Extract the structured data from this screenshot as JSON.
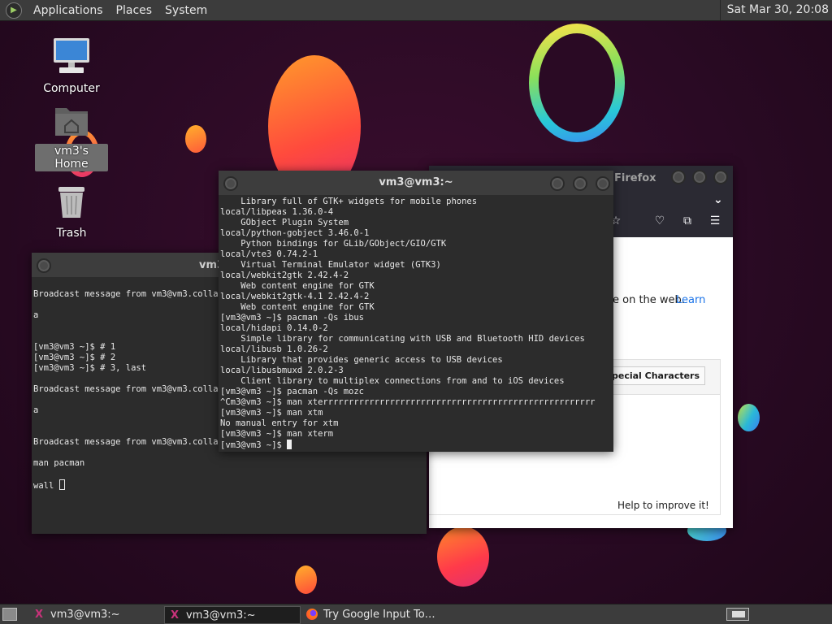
{
  "top_panel": {
    "menus": [
      "Applications",
      "Places",
      "System"
    ],
    "clock": "Sat Mar 30, 20:08"
  },
  "desktop": {
    "icons": [
      {
        "label": "Computer",
        "icon": "computer-icon"
      },
      {
        "label": "vm3's Home",
        "icon": "home-folder-icon"
      },
      {
        "label": "Trash",
        "icon": "trash-icon"
      }
    ]
  },
  "terminal_back": {
    "title": "vm3",
    "lines": [
      "",
      "Broadcast message from vm3@vm3.collabn",
      "",
      "a",
      "",
      "",
      "[vm3@vm3 ~]$ # 1",
      "[vm3@vm3 ~]$ # 2",
      "[vm3@vm3 ~]$ # 3, last",
      "",
      "Broadcast message from vm3@vm3.collabn",
      "",
      "a",
      "",
      "",
      "Broadcast message from vm3@vm3.collabn",
      "",
      "man pacman",
      ""
    ],
    "prompt_line": "wall "
  },
  "terminal_front": {
    "title": "vm3@vm3:~",
    "lines": [
      "    Library full of GTK+ widgets for mobile phones",
      "local/libpeas 1.36.0-4",
      "    GObject Plugin System",
      "local/python-gobject 3.46.0-1",
      "    Python bindings for GLib/GObject/GIO/GTK",
      "local/vte3 0.74.2-1",
      "    Virtual Terminal Emulator widget (GTK3)",
      "local/webkit2gtk 2.42.4-2",
      "    Web content engine for GTK",
      "local/webkit2gtk-4.1 2.42.4-2",
      "    Web content engine for GTK",
      "[vm3@vm3 ~]$ pacman -Qs ibus",
      "local/hidapi 0.14.0-2",
      "    Simple library for communicating with USB and Bluetooth HID devices",
      "local/libusb 1.0.26-2",
      "    Library that provides generic access to USB devices",
      "local/libusbmuxd 2.0.2-3",
      "    Client library to multiplex connections from and to iOS devices",
      "[vm3@vm3 ~]$ pacman -Qs mozc",
      "^Cm3@vm3 ~]$ man xterrrrrrrrrrrrrrrrrrrrrrrrrrrrrrrrrrrrrrrrrrrrrrrrrrrrr",
      "[vm3@vm3 ~]$ man xtm",
      "No manual entry for xtm",
      "[vm3@vm3 ~]$ man xterm"
    ],
    "prompt_line": "[vm3@vm3 ~]$ "
  },
  "firefox": {
    "title": "Firefox",
    "text_fragment": "e on the web.",
    "learn_link": "Learn",
    "special_chars_button": "pecial Characters",
    "help_text": "Help to improve it!"
  },
  "taskbar": {
    "tasks": [
      {
        "label": "vm3@vm3:~",
        "active": false
      },
      {
        "label": "vm3@vm3:~",
        "active": true
      },
      {
        "label": "Try Google Input To…",
        "active": false
      }
    ]
  }
}
